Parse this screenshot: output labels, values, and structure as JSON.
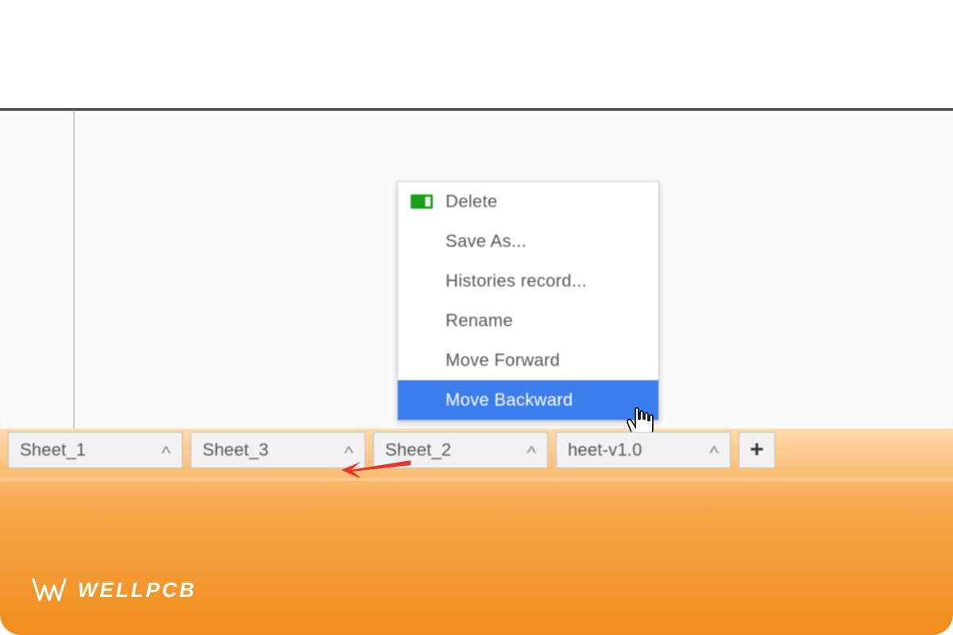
{
  "context_menu": {
    "items": [
      "Delete",
      "Save As...",
      "Histories record...",
      "Rename",
      "Move Forward",
      "Move Backward"
    ],
    "highlighted_index": 5
  },
  "tabs": {
    "items": [
      "Sheet_1",
      "Sheet_3",
      "Sheet_2",
      "heet-v1.0"
    ],
    "add_label": "+"
  },
  "brand": {
    "text": "WELLPCB"
  },
  "icons": {
    "battery": "battery-icon",
    "chevron_up": "^",
    "hand_cursor": "hand-cursor-icon",
    "arrow_annotation": "red-arrow-left"
  },
  "colors": {
    "highlight_bg": "#3b7ded",
    "highlight_fg": "#ffffff",
    "menu_fg": "#555555",
    "tab_bg": "#f2f2f2",
    "tab_border": "#bfbfbf",
    "arrow": "#ee3224",
    "gradient_orange": "#f18c1e"
  }
}
